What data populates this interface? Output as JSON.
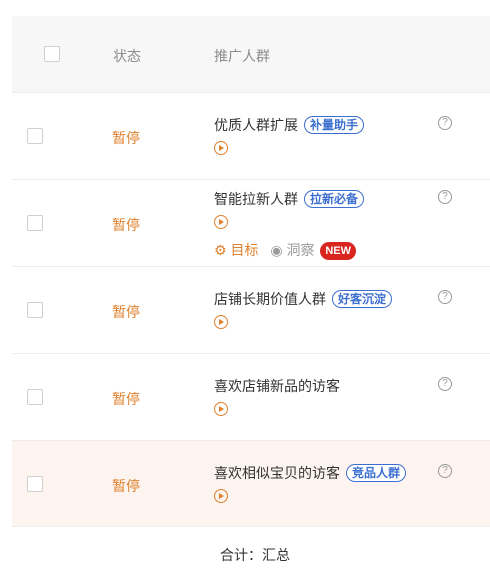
{
  "header": {
    "status_col": "状态",
    "audience_col": "推广人群"
  },
  "rows": [
    {
      "status": "暂停",
      "name": "优质人群扩展",
      "tag": "补量助手",
      "help": "?"
    },
    {
      "status": "暂停",
      "name": "智能拉新人群",
      "tag": "拉新必备",
      "help": "?",
      "goal": "目标",
      "insight": "洞察",
      "badge": "NEW"
    },
    {
      "status": "暂停",
      "name": "店铺长期价值人群",
      "tag": "好客沉淀",
      "help": "?"
    },
    {
      "status": "暂停",
      "name": "喜欢店铺新品的访客",
      "help": "?"
    },
    {
      "status": "暂停",
      "name": "喜欢相似宝贝的访客",
      "tag": "竞品人群",
      "help": "?"
    }
  ],
  "footer": {
    "total": "合计：汇总"
  },
  "colors": {
    "accent": "#e0812e",
    "tag": "#3d6fd1",
    "badge": "#d8261f",
    "highlight_bg": "#fdf4ef"
  },
  "icons": [
    "checkbox",
    "play-circle-icon",
    "help-circle-icon",
    "gear-icon",
    "eye-icon"
  ]
}
